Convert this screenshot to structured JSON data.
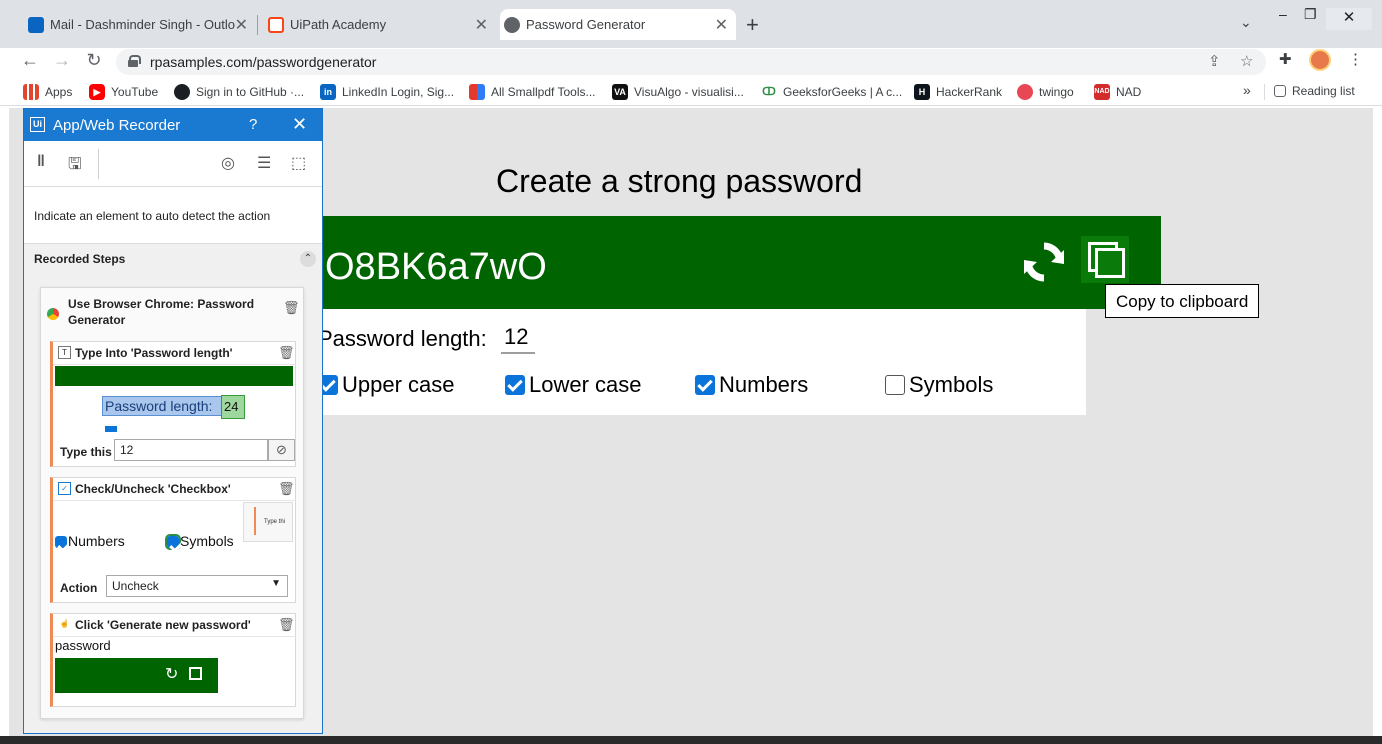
{
  "browser": {
    "tabs": [
      {
        "title": "Mail - Dashminder Singh - Outlo",
        "icon_color": "#0a64c2",
        "close": "✕"
      },
      {
        "title": "UiPath Academy",
        "icon_color": "#fa4616",
        "close": "✕"
      },
      {
        "title": "Password Generator",
        "icon_color": "#5f6368",
        "close": "✕"
      }
    ],
    "new_tab": "+",
    "url": "rpasamples.com/passwordgenerator",
    "bookmarks": [
      {
        "label": "Apps",
        "icon_color": "#e0452e"
      },
      {
        "label": "YouTube",
        "icon_color": "#ff0000"
      },
      {
        "label": "Sign in to GitHub ·...",
        "icon_color": "#1b1f23"
      },
      {
        "label": "LinkedIn Login, Sig...",
        "icon_color": "#0a66c2",
        "glyph": "in"
      },
      {
        "label": "All Smallpdf Tools...",
        "icon_color": "#e6392d"
      },
      {
        "label": "VisuAlgo - visualisi...",
        "icon_color": "#111111",
        "glyph": "VA"
      },
      {
        "label": "GeeksforGeeks | A c...",
        "icon_color": "#2f8d46",
        "glyph": "GG"
      },
      {
        "label": "HackerRank",
        "icon_color": "#0e141e",
        "glyph": "H"
      },
      {
        "label": "twingo",
        "icon_color": "#e84856"
      },
      {
        "label": "NAD",
        "icon_color": "#d42b2b",
        "glyph": "NAD"
      }
    ],
    "more_bookmarks": "»",
    "reading_list": "Reading list"
  },
  "page": {
    "title": "Create a strong password",
    "password": "O8BK6a7wO",
    "tooltip": "Copy to clipboard",
    "length_label": "Password length:",
    "length_value": "12",
    "options": [
      {
        "label": "Upper case",
        "checked": true
      },
      {
        "label": "Lower case",
        "checked": true
      },
      {
        "label": "Numbers",
        "checked": true
      },
      {
        "label": "Symbols",
        "checked": false
      }
    ],
    "accent": "#006400"
  },
  "recorder": {
    "title": "App/Web Recorder",
    "help": "?",
    "close": "✕",
    "hint": "Indicate an element to auto detect the action",
    "section": "Recorded Steps",
    "sequence_title": "Use Browser Chrome: Password Generator",
    "steps": [
      {
        "title": "Type Into 'Password length'",
        "field_label": "Type this",
        "field_value": "12",
        "preview_label": "Password length:",
        "preview_value": "24"
      },
      {
        "title": "Check/Uncheck 'Checkbox'",
        "field_label": "Action",
        "field_value": "Uncheck",
        "preview_a": "Numbers",
        "preview_b": "Symbols",
        "preview_mini": "Type thi"
      },
      {
        "title": "Click 'Generate new password'",
        "preview_label": "password"
      }
    ],
    "accent": "#1a79d0"
  }
}
